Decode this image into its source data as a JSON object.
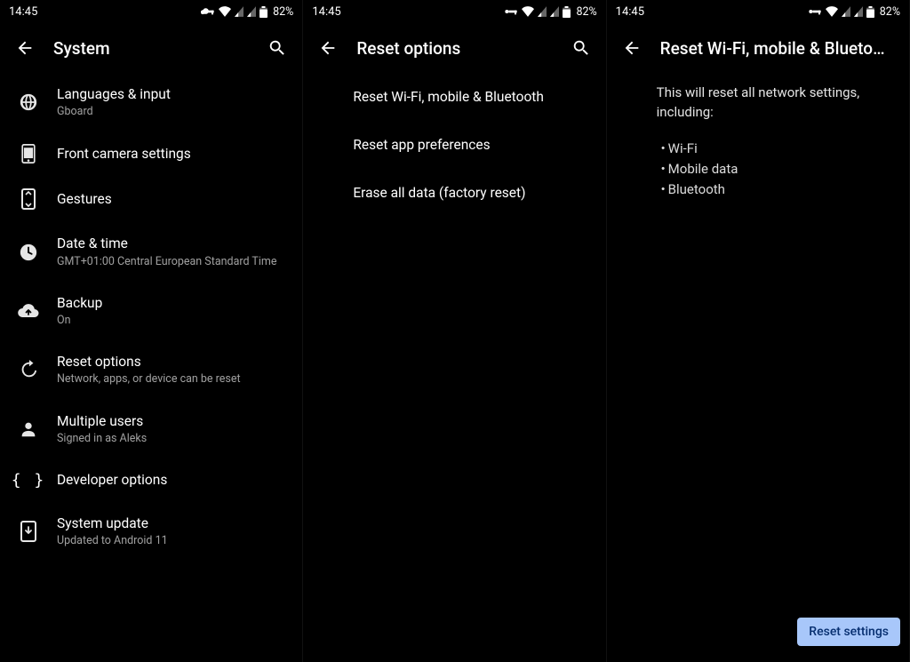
{
  "status": {
    "time": "14:45",
    "battery_pct": "82%"
  },
  "pane1": {
    "title": "System",
    "items": [
      {
        "title": "Languages & input",
        "sub": "Gboard"
      },
      {
        "title": "Front camera settings",
        "sub": ""
      },
      {
        "title": "Gestures",
        "sub": ""
      },
      {
        "title": "Date & time",
        "sub": "GMT+01:00 Central European Standard Time"
      },
      {
        "title": "Backup",
        "sub": "On"
      },
      {
        "title": "Reset options",
        "sub": "Network, apps, or device can be reset"
      },
      {
        "title": "Multiple users",
        "sub": "Signed in as Aleks"
      },
      {
        "title": "Developer options",
        "sub": ""
      },
      {
        "title": "System update",
        "sub": "Updated to Android 11"
      }
    ]
  },
  "pane2": {
    "title": "Reset options",
    "items": [
      {
        "title": "Reset Wi-Fi, mobile & Bluetooth"
      },
      {
        "title": "Reset app preferences"
      },
      {
        "title": "Erase all data (factory reset)"
      }
    ]
  },
  "pane3": {
    "title": "Reset Wi-Fi, mobile & Blueto…",
    "intro": "This will reset all network settings, including:",
    "bullets": [
      "Wi-Fi",
      "Mobile data",
      "Bluetooth"
    ],
    "button": "Reset settings"
  }
}
